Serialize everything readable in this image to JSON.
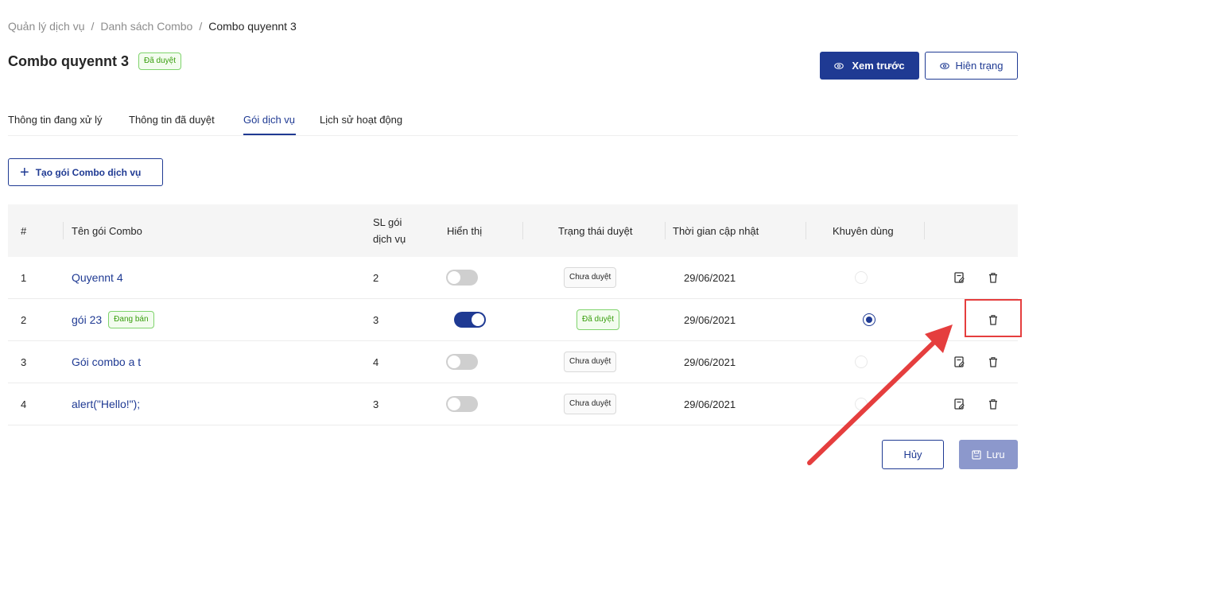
{
  "breadcrumb": {
    "items": [
      "Quản lý dịch vụ",
      "Danh sách Combo",
      "Combo quyennt 3"
    ],
    "separator": "/"
  },
  "header": {
    "title": "Combo quyennt 3",
    "status_badge": "Đã duyệt",
    "preview_button": "Xem trước",
    "status_button": "Hiện trạng"
  },
  "tabs": [
    {
      "label": "Thông tin đang xử lý",
      "active": false
    },
    {
      "label": "Thông tin đã duyệt",
      "active": false
    },
    {
      "label": "Gói dịch vụ",
      "active": true
    },
    {
      "label": "Lịch sử hoạt động",
      "active": false
    }
  ],
  "create_button": "Tạo gói Combo dịch vụ",
  "table": {
    "headers": {
      "index": "#",
      "name": "Tên gói Combo",
      "count_line1": "SL gói",
      "count_line2": "dịch vụ",
      "display": "Hiển thị",
      "approval": "Trạng thái duyệt",
      "updated": "Thời gian cập nhật",
      "recommended": "Khuyên dùng"
    },
    "rows": [
      {
        "index": "1",
        "name": "Quyennt 4",
        "tag": "",
        "count": "2",
        "display_on": false,
        "approval": "Chưa duyệt",
        "approved": false,
        "updated": "29/06/2021",
        "recommended": false,
        "has_edit": true
      },
      {
        "index": "2",
        "name": "gói 23",
        "tag": "Đang bán",
        "count": "3",
        "display_on": true,
        "approval": "Đã duyệt",
        "approved": true,
        "updated": "29/06/2021",
        "recommended": true,
        "has_edit": false
      },
      {
        "index": "3",
        "name": "Gói combo a t",
        "tag": "",
        "count": "4",
        "display_on": false,
        "approval": "Chưa duyệt",
        "approved": false,
        "updated": "29/06/2021",
        "recommended": false,
        "has_edit": true
      },
      {
        "index": "4",
        "name": "alert(\"Hello!\");",
        "tag": "",
        "count": "3",
        "display_on": false,
        "approval": "Chưa duyệt",
        "approved": false,
        "updated": "29/06/2021",
        "recommended": false,
        "has_edit": true
      }
    ]
  },
  "footer": {
    "cancel_button": "Hủy",
    "save_button": "Lưu"
  },
  "colors": {
    "primary": "#1f3a93",
    "approved_green": "#389e0d",
    "annotation_red": "#e53e3e"
  },
  "icons": [
    "eye-icon",
    "plus-icon",
    "edit-icon",
    "trash-icon",
    "save-icon"
  ]
}
